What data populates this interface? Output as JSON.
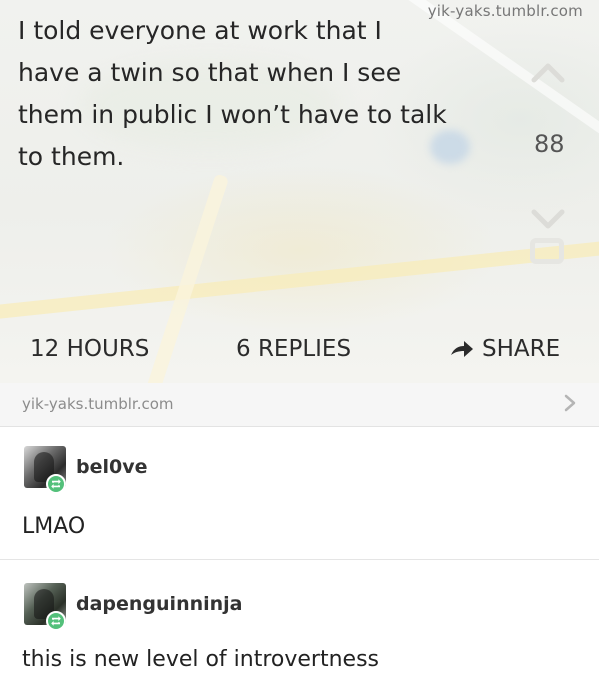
{
  "yak": {
    "watermark": "yik-yaks.tumblr.com",
    "lines": [
      "I told everyone at work that I",
      "have a twin so that when I see",
      "them in public I won’t have to talk",
      "to them."
    ],
    "votes": "88",
    "meta": {
      "hours": "12 HOURS",
      "replies": "6 REPLIES",
      "share": "SHARE"
    }
  },
  "source": {
    "label": "yik-yaks.tumblr.com"
  },
  "comments": [
    {
      "username": "bel0ve",
      "text": "LMAO"
    },
    {
      "username": "dapenguinninja",
      "text": "this is new level of introvertness"
    }
  ],
  "icons": {
    "upvote": "chevron-up-icon",
    "downvote": "chevron-down-icon",
    "share": "arrow-right-icon",
    "source_link": "chevron-right-icon",
    "reblog": "reblog-icon"
  },
  "colors": {
    "reblog_badge": "#53c07a",
    "meta_text": "#2b2b2b",
    "source_bg": "#f6f6f6"
  }
}
